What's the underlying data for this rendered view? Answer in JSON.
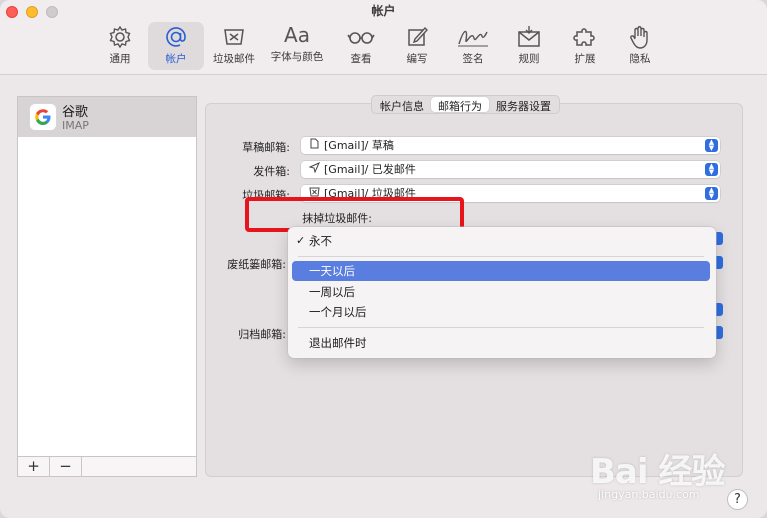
{
  "window": {
    "title": "帐户"
  },
  "toolbar": {
    "items": [
      {
        "label": "通用",
        "icon": "gear-icon"
      },
      {
        "label": "帐户",
        "icon": "at-sign-icon"
      },
      {
        "label": "垃圾邮件",
        "icon": "junk-tray-icon"
      },
      {
        "label": "字体与颜色",
        "icon": "font-icon"
      },
      {
        "label": "查看",
        "icon": "glasses-icon"
      },
      {
        "label": "编写",
        "icon": "compose-icon"
      },
      {
        "label": "签名",
        "icon": "signature-icon"
      },
      {
        "label": "规则",
        "icon": "rules-envelope-icon"
      },
      {
        "label": "扩展",
        "icon": "puzzle-icon"
      },
      {
        "label": "隐私",
        "icon": "hand-icon"
      }
    ],
    "font_icon_text": "Aa"
  },
  "sidebar": {
    "account_name": "谷歌",
    "account_type": "IMAP",
    "add_label": "+",
    "remove_label": "−"
  },
  "tabs": [
    "帐户信息",
    "邮箱行为",
    "服务器设置"
  ],
  "fields": {
    "drafts": {
      "label": "草稿邮箱:",
      "value": "[Gmail]/ 草稿"
    },
    "sent": {
      "label": "发件箱:",
      "value": "[Gmail]/ 已发邮件"
    },
    "junk": {
      "label": "垃圾邮箱:",
      "value": "[Gmail]/ 垃圾邮件"
    },
    "erase_junk_label": "抹掉垃圾邮件:",
    "trash_label": "废纸篓邮箱:",
    "archive_label": "归档邮箱:"
  },
  "dropdown": {
    "checkmark": "✓",
    "items": [
      "永不",
      "一天以后",
      "一周以后",
      "一个月以后",
      "退出邮件时"
    ],
    "checked_index": 0,
    "selected_index": 1
  },
  "help_label": "?",
  "watermark": {
    "text": "Bai 经验",
    "url": "jingyan.baidu.com"
  },
  "colors": {
    "accent": "#2f6ee0",
    "highlight_box": "#e8141b",
    "selection": "#5a7ee0"
  }
}
